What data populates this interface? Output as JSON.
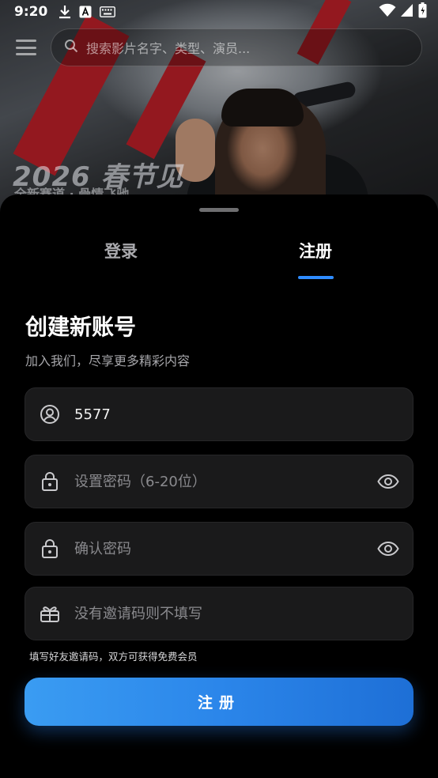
{
  "status_bar": {
    "time": "9:20",
    "icons": [
      "download-icon",
      "keyboard-a-icon",
      "keyboard-icon",
      "wifi-icon",
      "signal-icon",
      "battery-icon"
    ]
  },
  "top_bar": {
    "search_placeholder": "搜索影片名字、类型、演员..."
  },
  "poster": {
    "event_title": "2026 春节见",
    "event_subtitle": "全新赛道 · 骨情飞驰"
  },
  "tabs": {
    "login": "登录",
    "register": "注册",
    "active": "register"
  },
  "form": {
    "title": "创建新账号",
    "subtitle": "加入我们，尽享更多精彩内容",
    "username_value": "5577",
    "password_placeholder": "设置密码（6-20位）",
    "confirm_placeholder": "确认密码",
    "invite_placeholder": "没有邀请码则不填写",
    "invite_hint": "填写好友邀请码，双方可获得免费会员",
    "submit_label": "注册"
  },
  "colors": {
    "accent": "#2f8cff",
    "button_gradient_start": "#3a9cf2",
    "button_gradient_end": "#1e6fd6",
    "field_bg": "#1a1a1b",
    "sheet_bg": "#000000"
  }
}
